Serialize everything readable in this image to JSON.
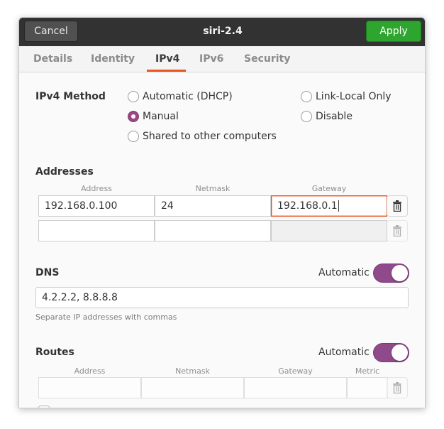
{
  "header": {
    "cancel_label": "Cancel",
    "title": "siri-2.4",
    "apply_label": "Apply"
  },
  "tabs": [
    "Details",
    "Identity",
    "IPv4",
    "IPv6",
    "Security"
  ],
  "active_tab": "IPv4",
  "ipv4_method": {
    "label": "IPv4 Method",
    "options": [
      "Automatic (DHCP)",
      "Link-Local Only",
      "Manual",
      "Disable",
      "Shared to other computers"
    ],
    "selected": "Manual"
  },
  "addresses": {
    "title": "Addresses",
    "columns": [
      "Address",
      "Netmask",
      "Gateway"
    ],
    "rows": [
      {
        "address": "192.168.0.100",
        "netmask": "24",
        "gateway": "192.168.0.1"
      },
      {
        "address": "",
        "netmask": "",
        "gateway": ""
      }
    ]
  },
  "dns": {
    "title": "DNS",
    "automatic_label": "Automatic",
    "automatic_on": true,
    "value": "4.2.2.2, 8.8.8.8",
    "hint": "Separate IP addresses with commas"
  },
  "routes": {
    "title": "Routes",
    "automatic_label": "Automatic",
    "automatic_on": true,
    "columns": [
      "Address",
      "Netmask",
      "Gateway",
      "Metric"
    ]
  },
  "colors": {
    "accent": "#e95420",
    "toggle": "#8e4a8a",
    "apply": "#2ea52e",
    "headerbar": "#323232"
  },
  "icons": {
    "trash": "trash-icon"
  }
}
